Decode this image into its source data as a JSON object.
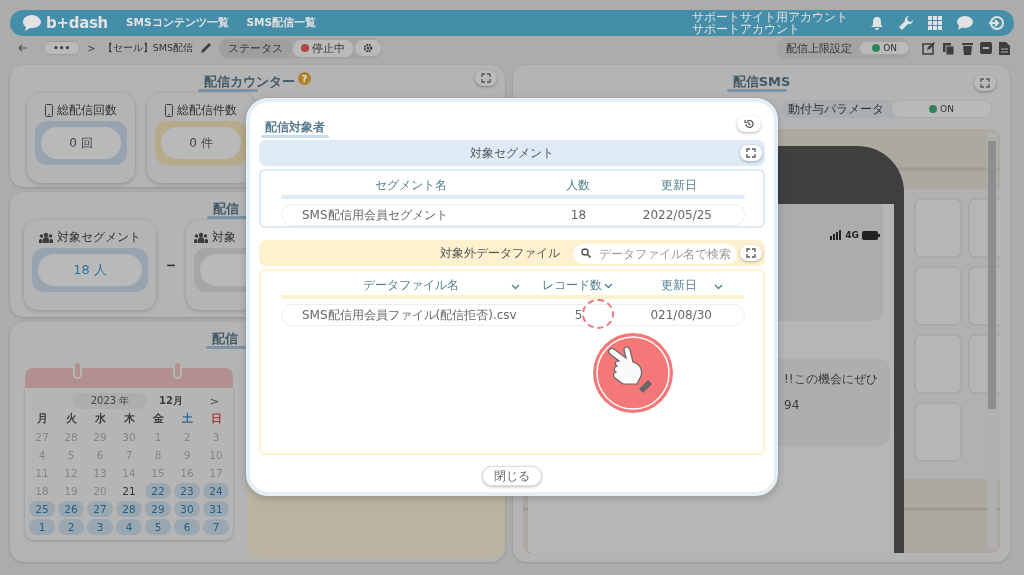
{
  "header": {
    "logo": "b+dash",
    "nav": [
      {
        "label": "SMSコンテンツ一覧"
      },
      {
        "label": "SMS配信一覧"
      }
    ],
    "account": [
      "サポートサイト用アカウント",
      "サポートアカウント"
    ]
  },
  "toolbar": {
    "more": "•••",
    "separator": ">",
    "title": "【セール】SMS配信",
    "status_label": "ステータス",
    "status": {
      "label": "停止中",
      "color": "#b04646"
    },
    "limit_label": "配信上限設定",
    "limit_toggle": {
      "label": "ON",
      "on": true
    }
  },
  "counter_panel": {
    "title": "配信カウンター",
    "help": "?",
    "cards": [
      {
        "label": "総配信回数",
        "value": "0 回",
        "color": "#97a4b0"
      },
      {
        "label": "総配信件数",
        "value": "0 件",
        "color": "#b5aa8a"
      }
    ]
  },
  "target_panel": {
    "title": "配信",
    "operator": "－",
    "cards": [
      {
        "label": "対象セグメント",
        "value": "18 人",
        "color": "#97a4b0"
      },
      {
        "label": "対象",
        "color": "#a6a6a6"
      }
    ]
  },
  "schedule_panel": {
    "title": "配信",
    "calendar": {
      "year": "2023 年",
      "month": "12月",
      "next": ">",
      "weekdays": [
        {
          "label": "月",
          "color": "#3e3e3e"
        },
        {
          "label": "火",
          "color": "#3e3e3e"
        },
        {
          "label": "水",
          "color": "#3e3e3e"
        },
        {
          "label": "木",
          "color": "#3e3e3e"
        },
        {
          "label": "金",
          "color": "#3e3e3e"
        },
        {
          "label": "土",
          "color": "#2b6898"
        },
        {
          "label": "日",
          "color": "#a83434"
        }
      ],
      "days": [
        {
          "label": "27",
          "disabled": true,
          "available": false
        },
        {
          "label": "28",
          "disabled": true,
          "available": false
        },
        {
          "label": "29",
          "disabled": true,
          "available": false
        },
        {
          "label": "30",
          "disabled": true,
          "available": false
        },
        {
          "label": "1",
          "disabled": true,
          "available": false
        },
        {
          "label": "2",
          "disabled": true,
          "available": false
        },
        {
          "label": "3",
          "disabled": true,
          "available": false
        },
        {
          "label": "4",
          "disabled": true,
          "available": false
        },
        {
          "label": "5",
          "disabled": true,
          "available": false
        },
        {
          "label": "6",
          "disabled": true,
          "available": false
        },
        {
          "label": "7",
          "disabled": true,
          "available": false
        },
        {
          "label": "8",
          "disabled": true,
          "available": false
        },
        {
          "label": "9",
          "disabled": true,
          "available": false
        },
        {
          "label": "10",
          "disabled": true,
          "available": false
        },
        {
          "label": "11",
          "disabled": true,
          "available": false
        },
        {
          "label": "12",
          "disabled": true,
          "available": false
        },
        {
          "label": "13",
          "disabled": true,
          "available": false
        },
        {
          "label": "14",
          "disabled": true,
          "available": false
        },
        {
          "label": "15",
          "disabled": true,
          "available": false
        },
        {
          "label": "16",
          "disabled": true,
          "available": false
        },
        {
          "label": "17",
          "disabled": true,
          "available": false
        },
        {
          "label": "18",
          "disabled": true,
          "available": false
        },
        {
          "label": "19",
          "disabled": true,
          "available": false
        },
        {
          "label": "20",
          "disabled": true,
          "available": false
        },
        {
          "label": "21",
          "disabled": false,
          "available": false
        },
        {
          "label": "22",
          "disabled": false,
          "available": true
        },
        {
          "label": "23",
          "disabled": false,
          "available": true
        },
        {
          "label": "24",
          "disabled": false,
          "available": true
        },
        {
          "label": "25",
          "disabled": false,
          "available": true
        },
        {
          "label": "26",
          "disabled": false,
          "available": true
        },
        {
          "label": "27",
          "disabled": false,
          "available": true
        },
        {
          "label": "28",
          "disabled": false,
          "available": true
        },
        {
          "label": "29",
          "disabled": false,
          "available": true
        },
        {
          "label": "30",
          "disabled": false,
          "available": true
        },
        {
          "label": "31",
          "disabled": false,
          "available": true
        },
        {
          "label": "1",
          "disabled": false,
          "available": true
        },
        {
          "label": "2",
          "disabled": false,
          "available": true
        },
        {
          "label": "3",
          "disabled": false,
          "available": true
        },
        {
          "label": "4",
          "disabled": false,
          "available": true
        },
        {
          "label": "5",
          "disabled": false,
          "available": true
        },
        {
          "label": "6",
          "disabled": false,
          "available": true
        },
        {
          "label": "7",
          "disabled": false,
          "available": true
        }
      ]
    }
  },
  "sms_panel": {
    "title": "配信SMS",
    "param_label": "動付与パラメータ",
    "param_toggle": {
      "label": "ON",
      "on": true
    },
    "phone": {
      "network": "4G",
      "message_lines": [
        "!!この機会にぜひ",
        "94"
      ]
    }
  },
  "modal": {
    "title": "配信対象者",
    "segments": {
      "title": "対象セグメント",
      "columns": [
        "セグメント名",
        "人数",
        "更新日"
      ],
      "rows": [
        [
          "SMS配信用会員セグメント",
          "18",
          "2022/05/25"
        ]
      ]
    },
    "excluded": {
      "title": "対象外データファイル",
      "search_placeholder": "データファイル名で検索",
      "columns": [
        "データファイル名",
        "レコード数",
        "更新日"
      ],
      "rows": [
        [
          "SMS配信用会員ファイル(配信拒否).csv",
          "5",
          "021/08/30"
        ]
      ]
    },
    "close": "閉じる"
  }
}
